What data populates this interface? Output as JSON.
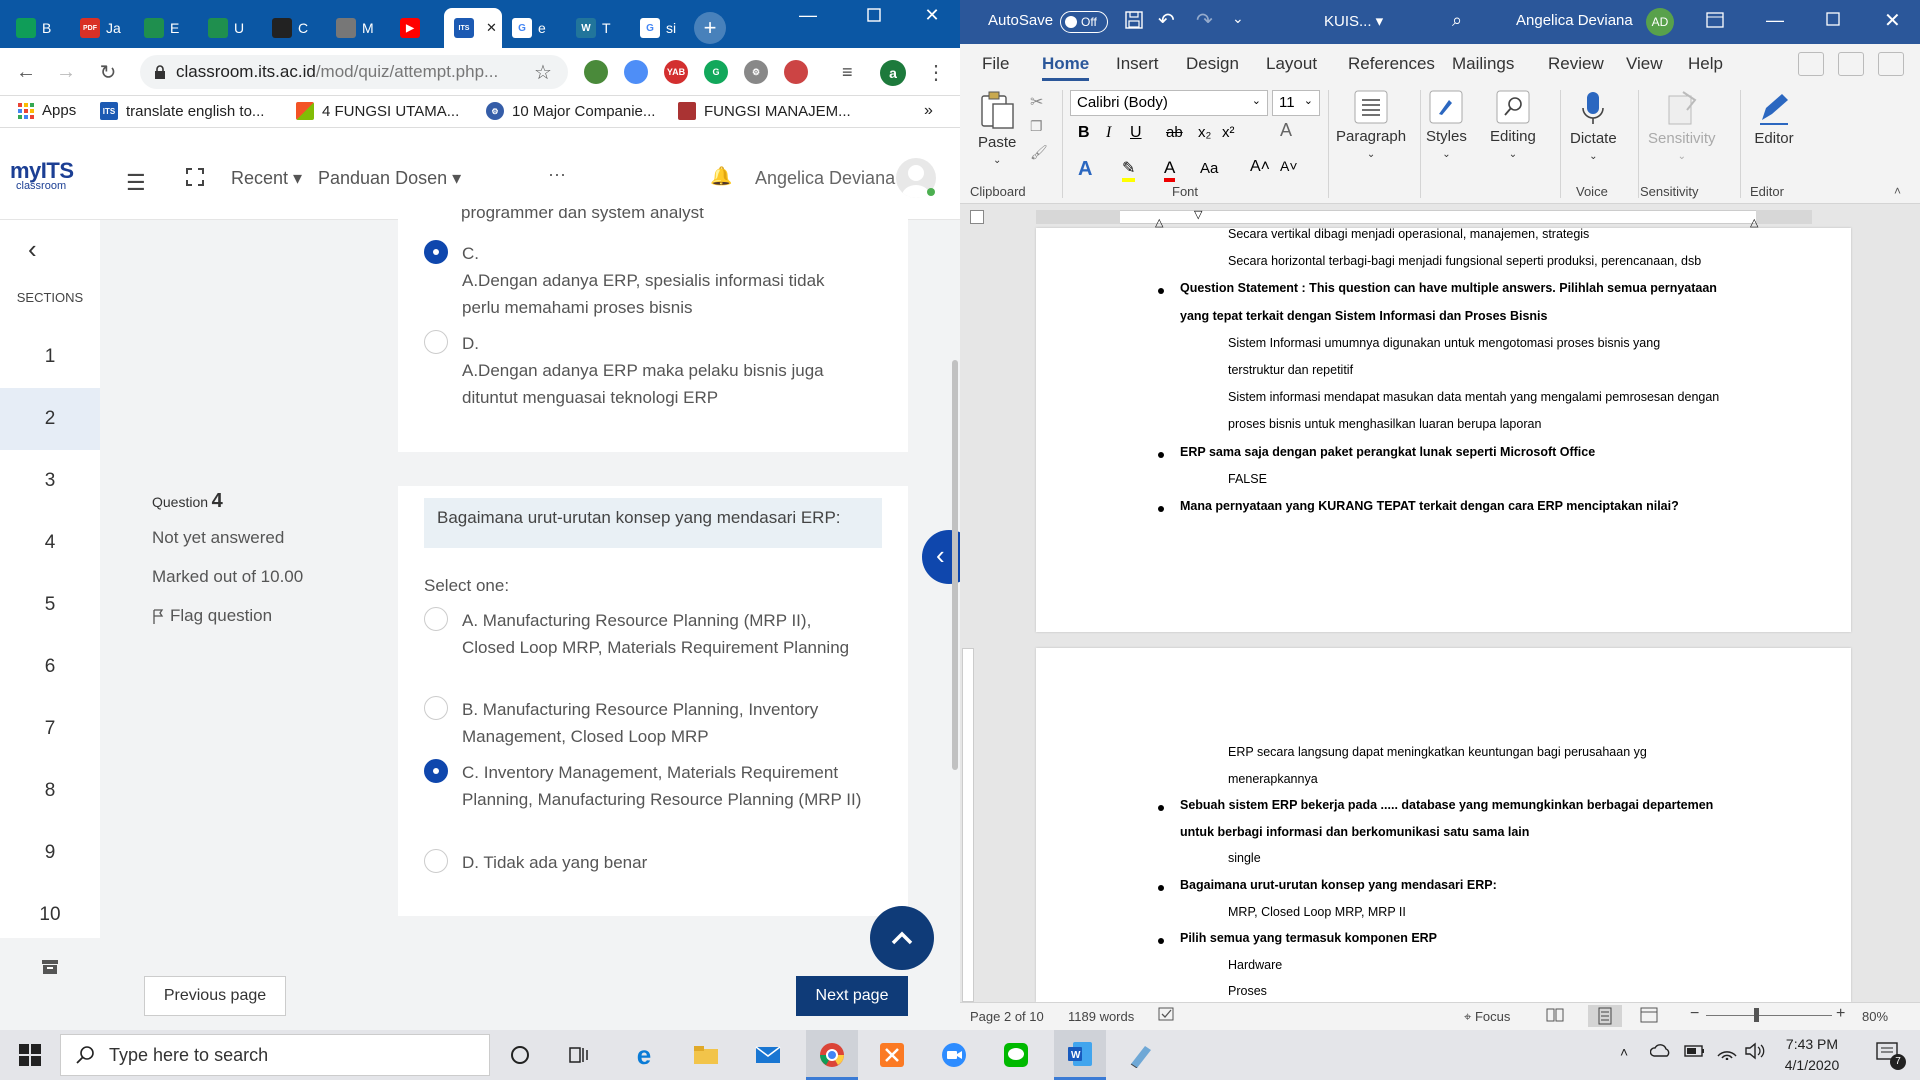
{
  "chrome": {
    "tabs": [
      {
        "label": "B",
        "icon": "classroom-icon"
      },
      {
        "label": "Ja",
        "icon": "pdf-icon"
      },
      {
        "label": "E",
        "icon": "drive-icon"
      },
      {
        "label": "U",
        "icon": "drive-icon"
      },
      {
        "label": "C",
        "icon": "app-icon"
      },
      {
        "label": "M",
        "icon": "smt-icon"
      },
      {
        "label": "",
        "icon": "youtube-icon"
      },
      {
        "label": "",
        "icon": "its-icon"
      },
      {
        "label": "e",
        "icon": "google-icon"
      },
      {
        "label": "T",
        "icon": "wordpress-icon"
      },
      {
        "label": "si",
        "icon": "google-icon"
      }
    ],
    "active_tab_close": "✕",
    "new_tab": "+",
    "url_host": "classroom.its.ac.id",
    "url_path": "/mod/quiz/attempt.php...",
    "profile_letter": "a",
    "bookmarks": [
      {
        "label": "Apps"
      },
      {
        "label": "translate english to..."
      },
      {
        "label": "4 FUNGSI UTAMA..."
      },
      {
        "label": "10 Major Companie..."
      },
      {
        "label": "FUNGSI MANAJEM..."
      }
    ],
    "bookmarks_more": "»"
  },
  "moodle": {
    "logo_main": "myITS",
    "logo_sub": "classroom",
    "nav_recent": "Recent",
    "nav_panduan": "Panduan Dosen",
    "nav_more": "···",
    "user_name": "Angelica Deviana",
    "sections_label": "SECTIONS",
    "sections": [
      "1",
      "2",
      "3",
      "4",
      "5",
      "6",
      "7",
      "8",
      "9",
      "10"
    ],
    "active_section": "2",
    "prev_question": {
      "cut_text": "programmer dan system analyst",
      "options": [
        {
          "letter": "C.",
          "text": "A.Dengan adanya ERP, spesialis informasi tidak perlu memahami proses bisnis",
          "selected": true
        },
        {
          "letter": "D.",
          "text": "A.Dengan adanya ERP maka pelaku bisnis juga dituntut menguasai teknologi ERP",
          "selected": false
        }
      ]
    },
    "question": {
      "label": "Question",
      "number": "4",
      "status": "Not yet answered",
      "marks": "Marked out of 10.00",
      "flag": "Flag question",
      "text": "Bagaimana urut-urutan konsep yang mendasari ERP:",
      "select_one": "Select one:",
      "options": [
        {
          "text": "A. Manufacturing Resource Planning (MRP II), Closed Loop MRP, Materials Requirement Planning",
          "selected": false
        },
        {
          "text": "B. Manufacturing Resource Planning, Inventory Management, Closed Loop MRP",
          "selected": false
        },
        {
          "text": "C. Inventory Management, Materials Requirement Planning, Manufacturing Resource Planning (MRP II)",
          "selected": true
        },
        {
          "text": "D. Tidak ada yang benar",
          "selected": false
        }
      ]
    },
    "prev_button": "Previous page",
    "next_button": "Next page"
  },
  "word": {
    "autosave_label": "AutoSave",
    "autosave_state": "Off",
    "doc_title": "KUIS...",
    "user_name": "Angelica Deviana",
    "user_initials": "AD",
    "menu": [
      "File",
      "Home",
      "Insert",
      "Design",
      "Layout",
      "References",
      "Mailings",
      "Review",
      "View",
      "Help"
    ],
    "active_menu": "Home",
    "font_name": "Calibri (Body)",
    "font_size": "11",
    "ribbon": {
      "paste": "Paste",
      "paragraph": "Paragraph",
      "styles": "Styles",
      "editing": "Editing",
      "dictate": "Dictate",
      "sensitivity": "Sensitivity",
      "editor": "Editor"
    },
    "groups": [
      "Clipboard",
      "Font",
      "Voice",
      "Sensitivity",
      "Editor"
    ],
    "page1": [
      {
        "text": "Secara vertikal dibagi menjadi operasional, manajemen, strategis",
        "bold": false,
        "bullet": false
      },
      {
        "text": "Secara horizontal terbagi-bagi menjadi fungsional seperti produksi, perencanaan, dsb",
        "bold": false,
        "bullet": false
      },
      {
        "text": "Question Statement : This question can have multiple answers. Pilihlah semua pernyataan",
        "bold": true,
        "bullet": true
      },
      {
        "text": "yang tepat terkait dengan Sistem Informasi dan Proses Bisnis",
        "bold": true,
        "bullet": false
      },
      {
        "text": "Sistem Informasi umumnya digunakan untuk mengotomasi proses bisnis yang",
        "bold": false,
        "bullet": false
      },
      {
        "text": "terstruktur dan repetitif",
        "bold": false,
        "bullet": false
      },
      {
        "text": "Sistem informasi mendapat masukan data mentah yang mengalami pemrosesan dengan",
        "bold": false,
        "bullet": false
      },
      {
        "text": "proses bisnis untuk menghasilkan luaran berupa laporan",
        "bold": false,
        "bullet": false
      },
      {
        "text": "ERP sama saja dengan paket perangkat lunak seperti Microsoft Office",
        "bold": true,
        "bullet": true
      },
      {
        "text": "FALSE",
        "bold": false,
        "bullet": false
      },
      {
        "text": "Mana pernyataan yang KURANG TEPAT terkait dengan cara ERP menciptakan nilai?",
        "bold": true,
        "bullet": true
      }
    ],
    "page2": [
      {
        "text": "ERP secara langsung dapat meningkatkan keuntungan bagi perusahaan yg",
        "bold": false,
        "bullet": false
      },
      {
        "text": "menerapkannya",
        "bold": false,
        "bullet": false
      },
      {
        "text": "Sebuah sistem ERP bekerja pada ..... database yang memungkinkan berbagai departemen",
        "bold": true,
        "bullet": true
      },
      {
        "text": "untuk berbagi informasi dan berkomunikasi satu sama lain",
        "bold": true,
        "bullet": false
      },
      {
        "text": "single",
        "bold": false,
        "bullet": false
      },
      {
        "text": "Bagaimana urut-urutan konsep yang mendasari ERP:",
        "bold": true,
        "bullet": true
      },
      {
        "text": "MRP, Closed Loop MRP, MRP II",
        "bold": false,
        "bullet": false
      },
      {
        "text": "Pilih semua yang termasuk komponen ERP",
        "bold": true,
        "bullet": true
      },
      {
        "text": "Hardware",
        "bold": false,
        "bullet": false
      },
      {
        "text": "Proses",
        "bold": false,
        "bullet": false
      }
    ],
    "status_page": "Page 2 of 10",
    "status_words": "1189 words",
    "status_focus": "Focus",
    "zoom": "80%"
  },
  "taskbar": {
    "search_placeholder": "Type here to search",
    "time": "7:43 PM",
    "date": "4/1/2020",
    "notif_count": "7"
  },
  "colors": {
    "chrome_tabstrip": "#0b57a4",
    "moodle_primary": "#0f47ad",
    "word_blue": "#2b579a"
  }
}
